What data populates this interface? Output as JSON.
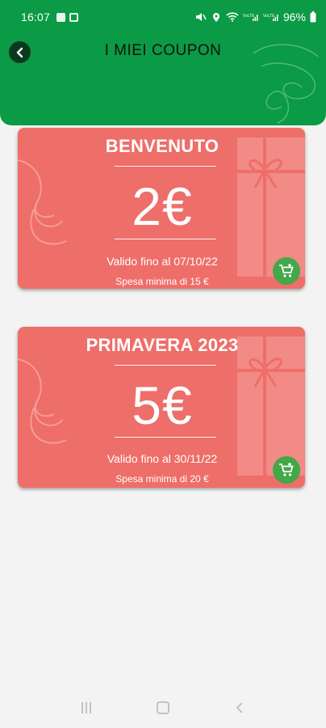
{
  "status_bar": {
    "time": "16:07",
    "battery": "96%"
  },
  "header": {
    "title": "I MIEI COUPON",
    "back_icon": "back-arrow-icon",
    "color": "#0b9a45"
  },
  "coupons": [
    {
      "title": "BENVENUTO",
      "value": "2€",
      "valid_until": "Valido fino al 07/10/22",
      "minimum_spend": "Spesa minima di 15 €",
      "cart_icon": "add-to-cart-icon"
    },
    {
      "title": "PRIMAVERA 2023",
      "value": "5€",
      "valid_until": "Valido fino al 30/11/22",
      "minimum_spend": "Spesa minima di 20 €",
      "cart_icon": "add-to-cart-icon"
    }
  ],
  "colors": {
    "coupon": "#ee6e69",
    "cart_button": "#42a848",
    "background": "#f3f3f3"
  },
  "nav_bar": {
    "icons": [
      "recent-apps-icon",
      "home-icon",
      "back-icon"
    ]
  }
}
